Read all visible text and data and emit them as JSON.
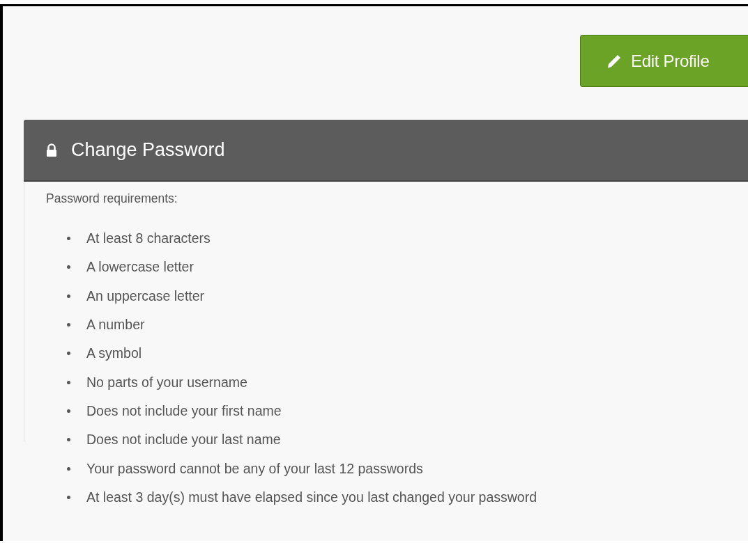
{
  "edit_button": {
    "label": "Edit Profile"
  },
  "panel": {
    "title": "Change Password",
    "intro": "Password requirements:",
    "requirements": [
      "At least 8 characters",
      "A lowercase letter",
      "An uppercase letter",
      "A number",
      "A symbol",
      "No parts of your username",
      "Does not include your first name",
      "Does not include your last name",
      "Your password cannot be any of your last 12 passwords",
      "At least 3 day(s) must have elapsed since you last changed your password"
    ]
  }
}
